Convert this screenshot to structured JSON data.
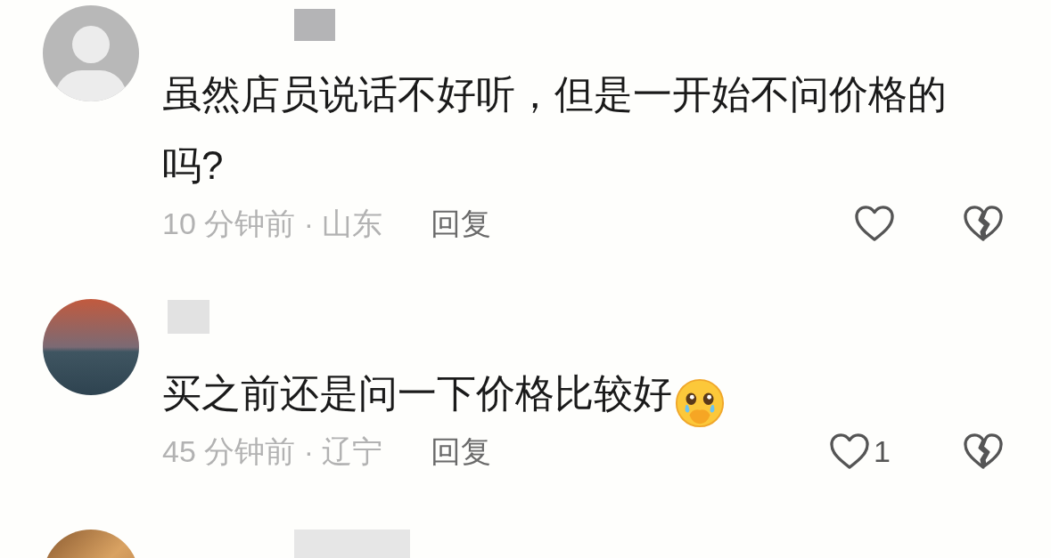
{
  "comments": [
    {
      "avatar": {
        "kind": "default"
      },
      "text": "虽然店员说话不好听，但是一开始不问价格的吗?",
      "meta": "10 分钟前 · 山东",
      "reply": "回复"
    },
    {
      "avatar": {
        "kind": "photo"
      },
      "text": "买之前还是问一下价格比较好",
      "emoji": {
        "kind": "crying-face"
      },
      "meta": "45 分钟前 · 辽宁",
      "reply": "回复",
      "like_count": "1"
    },
    {
      "avatar": {
        "kind": "photo-partial"
      }
    }
  ]
}
